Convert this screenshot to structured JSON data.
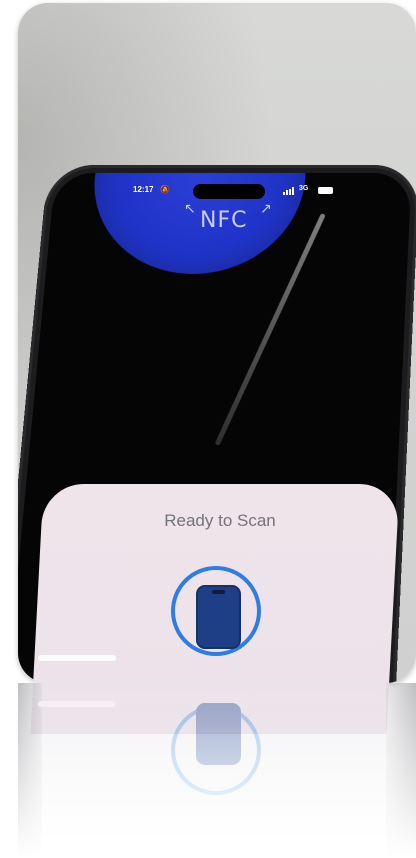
{
  "status_bar": {
    "time": "12:17",
    "bell_icon": "bell-slash-icon",
    "network": "3G",
    "signal_icon": "signal-bars-icon",
    "battery_icon": "battery-icon"
  },
  "nfc_indicator": {
    "label": "NFC",
    "arrow_left": "↖",
    "arrow_right": "↗"
  },
  "scan_sheet": {
    "title": "Ready to Scan",
    "icon": "phone-icon"
  },
  "colors": {
    "nfc_glow": "#1f33c8",
    "ring": "#2f7de1",
    "sheet": "#efe4ea"
  }
}
